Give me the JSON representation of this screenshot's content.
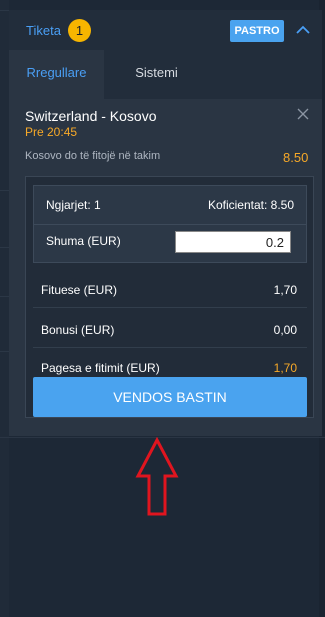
{
  "colors": {
    "accent": "#4aa3ef",
    "odds": "#f7a928",
    "badge": "#f7b500",
    "annotation": "#e0151f"
  },
  "header": {
    "title": "Tiketa",
    "count": "1",
    "clear_label": "PASTRO",
    "collapse_icon": "chevron-up-icon"
  },
  "tabs": [
    {
      "label": "Rregullare",
      "active": true
    },
    {
      "label": "Sistemi",
      "active": false
    }
  ],
  "event": {
    "name": "Switzerland - Kosovo",
    "time": "Pre 20:45",
    "selection": "Kosovo do të fitojë në takim",
    "odds": "8.50",
    "remove_icon": "close-icon"
  },
  "summary": {
    "events_label": "Ngjarjet: 1",
    "total_odds_label": "Koficientat: 8.50",
    "stake_label": "Shuma (EUR)",
    "stake_value": "0.2",
    "win_label": "Fituese (EUR)",
    "win_value": "1,70",
    "bonus_label": "Bonusi (EUR)",
    "bonus_value": "0,00",
    "payout_label": "Pagesa e fitimit (EUR)",
    "payout_value": "1,70"
  },
  "submit_label": "VENDOS BASTIN",
  "annotation": {
    "icon": "arrow-up-icon"
  }
}
